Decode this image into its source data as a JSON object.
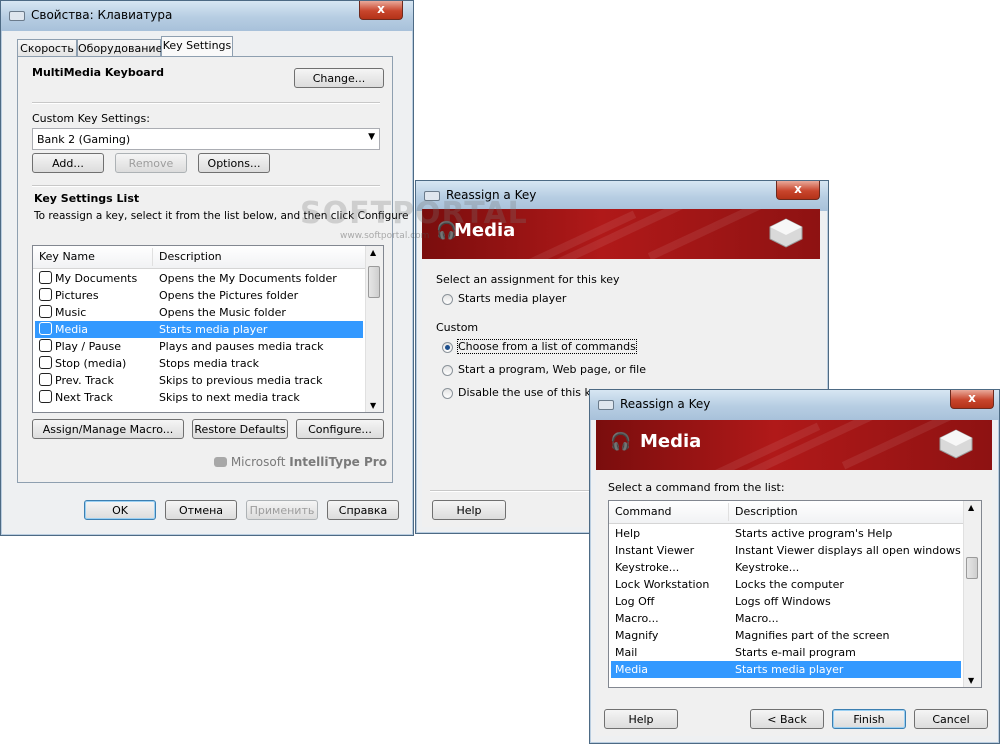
{
  "main_window": {
    "title": "Свойства: Клавиатура",
    "close": "x",
    "tabs": [
      "Скорость",
      "Оборудование",
      "Key Settings"
    ],
    "device_name": "MultiMedia Keyboard",
    "change_label": "Change...",
    "custom_key_label": "Custom Key Settings:",
    "bank_value": "Bank 2 (Gaming)",
    "add_label": "Add...",
    "remove_label": "Remove",
    "options_label": "Options...",
    "list_title": "Key Settings List",
    "list_hint": "To reassign a key, select it from the list below, and then click Configure",
    "columns": [
      "Key Name",
      "Description"
    ],
    "rows": [
      {
        "name": "My Documents",
        "desc": "Opens the My Documents folder",
        "icon": "documents-icon"
      },
      {
        "name": "Pictures",
        "desc": "Opens the Pictures folder",
        "icon": "camera-icon"
      },
      {
        "name": "Music",
        "desc": "Opens the Music folder",
        "icon": "headphones-icon"
      },
      {
        "name": "Media",
        "desc": "Starts media player",
        "icon": "headphones-icon",
        "selected": true
      },
      {
        "name": "Play / Pause",
        "desc": "Plays and pauses media track",
        "icon": "play-pause-icon"
      },
      {
        "name": "Stop (media)",
        "desc": "Stops media track",
        "icon": "stop-icon"
      },
      {
        "name": "Prev. Track",
        "desc": "Skips to previous media track",
        "icon": "prev-track-icon"
      },
      {
        "name": "Next Track",
        "desc": "Skips to next media track",
        "icon": "next-track-icon"
      }
    ],
    "assign_label": "Assign/Manage Macro...",
    "restore_label": "Restore Defaults",
    "configure_label": "Configure...",
    "brand_prefix": "Microsoft",
    "brand_name": "IntelliType Pro",
    "ok_label": "OK",
    "cancel_label": "Отмена",
    "apply_label": "Применить",
    "help_label": "Справка"
  },
  "reassign_window": {
    "title": "Reassign a Key",
    "banner_title": "Media",
    "prompt": "Select an assignment for this key",
    "option_default": "Starts media player",
    "custom_label": "Custom",
    "option_list": "Choose from a list of commands",
    "option_program": "Start a program, Web page, or file",
    "option_disable": "Disable the use of this key",
    "help_label": "Help"
  },
  "command_window": {
    "title": "Reassign a Key",
    "banner_title": "Media",
    "prompt": "Select a command from the list:",
    "columns": [
      "Command",
      "Description"
    ],
    "rows": [
      {
        "name": "Help",
        "desc": "Starts active program's Help"
      },
      {
        "name": "Instant Viewer",
        "desc": "Instant Viewer displays all open windows"
      },
      {
        "name": "Keystroke...",
        "desc": "Keystroke..."
      },
      {
        "name": "Lock Workstation",
        "desc": "Locks the computer"
      },
      {
        "name": "Log Off",
        "desc": "Logs off Windows"
      },
      {
        "name": "Macro...",
        "desc": "Macro..."
      },
      {
        "name": "Magnify",
        "desc": "Magnifies part of the screen"
      },
      {
        "name": "Mail",
        "desc": "Starts e-mail program"
      },
      {
        "name": "Media",
        "desc": "Starts media player",
        "selected": true
      }
    ],
    "help_label": "Help",
    "back_label": "< Back",
    "finish_label": "Finish",
    "cancel_label": "Cancel"
  },
  "watermark": {
    "text": "SOFTPORTAL",
    "sub": "www.softportal.com"
  },
  "colors": {
    "selection": "#3399ff",
    "banner": "#a51515",
    "close": "#c8452c"
  }
}
